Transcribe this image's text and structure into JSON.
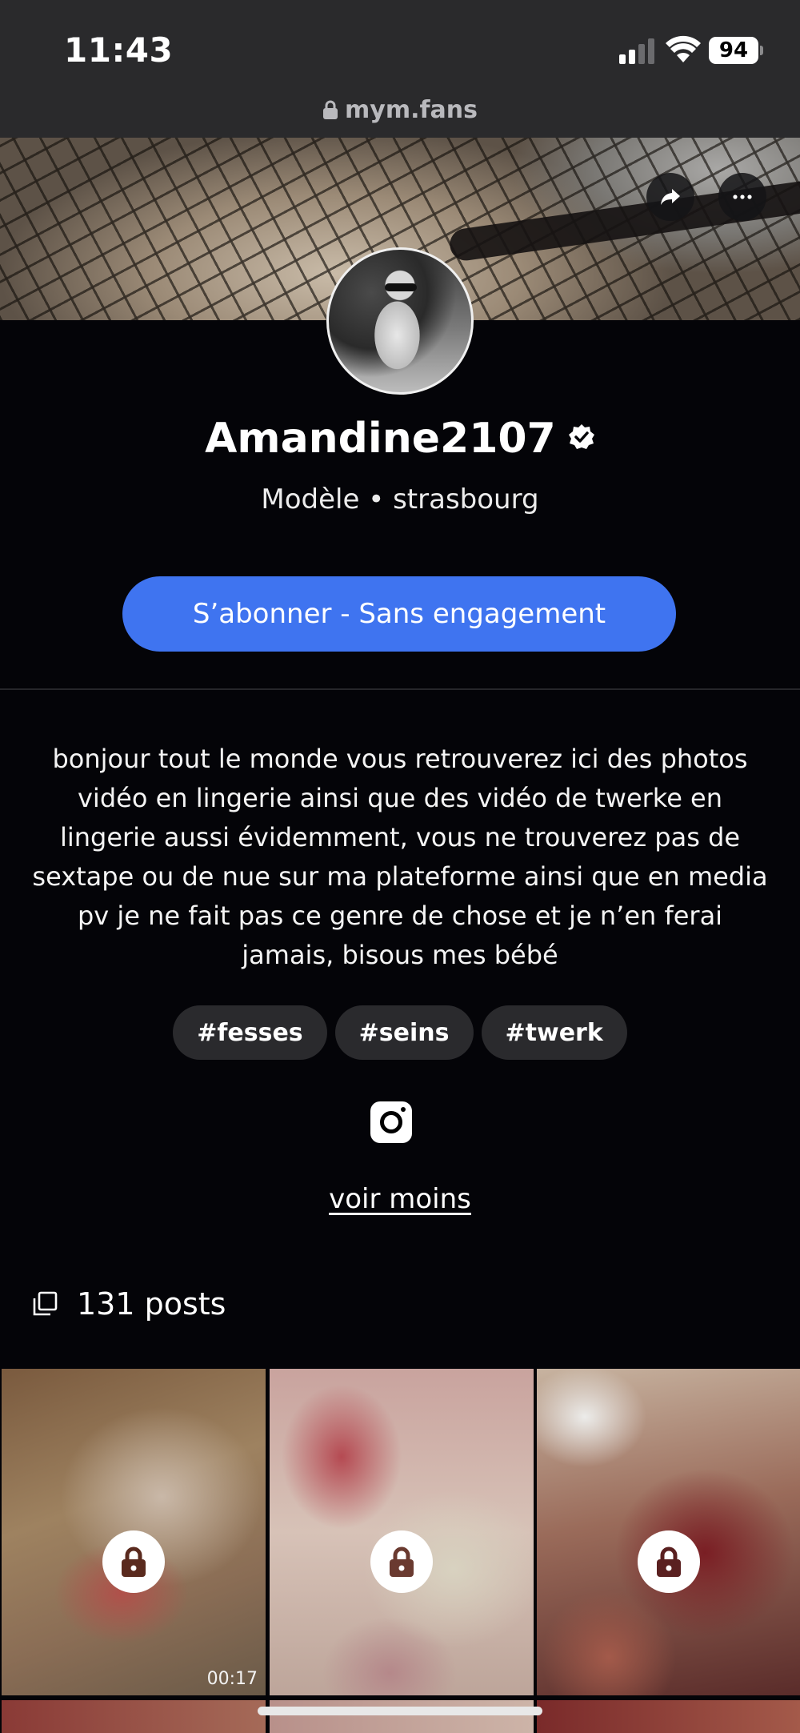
{
  "status_bar": {
    "time": "11:43",
    "battery": "94"
  },
  "browser": {
    "url": "mym.fans"
  },
  "profile": {
    "name": "Amandine2107",
    "subtitle": "Modèle • strasbourg",
    "subscribe_label": "S’abonner - Sans engagement",
    "bio": "bonjour tout le monde vous retrouverez ici des photos vidéo en lingerie ainsi que des vidéo de twerke en lingerie aussi évidemment, vous ne trouverez pas de sextape ou de nue sur ma plateforme ainsi que en media pv je ne fait pas ce genre de chose et je n’en ferai jamais, bisous mes bébé",
    "tags": [
      "#fesses",
      "#seins",
      "#twerk"
    ],
    "see_less_label": "voir moins",
    "posts_label": "131 posts"
  },
  "grid": {
    "tiles": [
      {
        "duration": "00:17",
        "locked": true
      },
      {
        "duration": "",
        "locked": true
      },
      {
        "duration": "",
        "locked": true
      }
    ]
  },
  "colors": {
    "accent": "#3f74f0",
    "background": "#040408",
    "tag_bg": "#2a2a2d"
  },
  "icons": [
    "share-icon",
    "more-icon",
    "verified-icon",
    "instagram-icon",
    "posts-icon",
    "lock-icon"
  ]
}
